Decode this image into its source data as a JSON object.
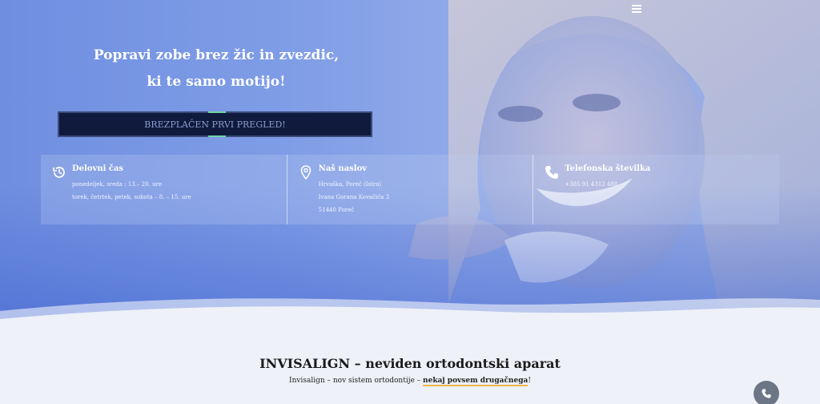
{
  "hero": {
    "headline_line1": "Popravi zobe brez žic in zvezdic,",
    "headline_line2": "ki te samo motijo!",
    "cta_label": "BREZPLAČEN PRVI PREGLED!"
  },
  "info": {
    "hours": {
      "title": "Delovni čas",
      "lines": [
        "ponedeljek, sreda : 13.– 20. ure",
        "torek, četrtek, petek, sobota – 8. – 15. ure"
      ],
      "icon": "clock-history-icon"
    },
    "address": {
      "title": "Naš naslov",
      "lines": [
        "Hrvaška, Poreč (Istra)",
        "Ivana Gorana Kovačića 3",
        "51440 Poreč"
      ],
      "icon": "map-pin-icon"
    },
    "phone": {
      "title": "Telefonska številka",
      "lines": [
        "+385 91 4312 488"
      ],
      "icon": "phone-icon"
    }
  },
  "section": {
    "title": "INVISALIGN – neviden ortodontski aparat",
    "subtitle_pre": "Invisalign – nov sistem ortodontije – ",
    "subtitle_highlight": "nekaj povsem drugačnega",
    "subtitle_post": "!"
  },
  "colors": {
    "hero_blue": "#7f9de6",
    "cta_bg": "#0f1a3d",
    "accent_green": "#6fd3a6",
    "highlight_orange": "#f0b84a"
  }
}
